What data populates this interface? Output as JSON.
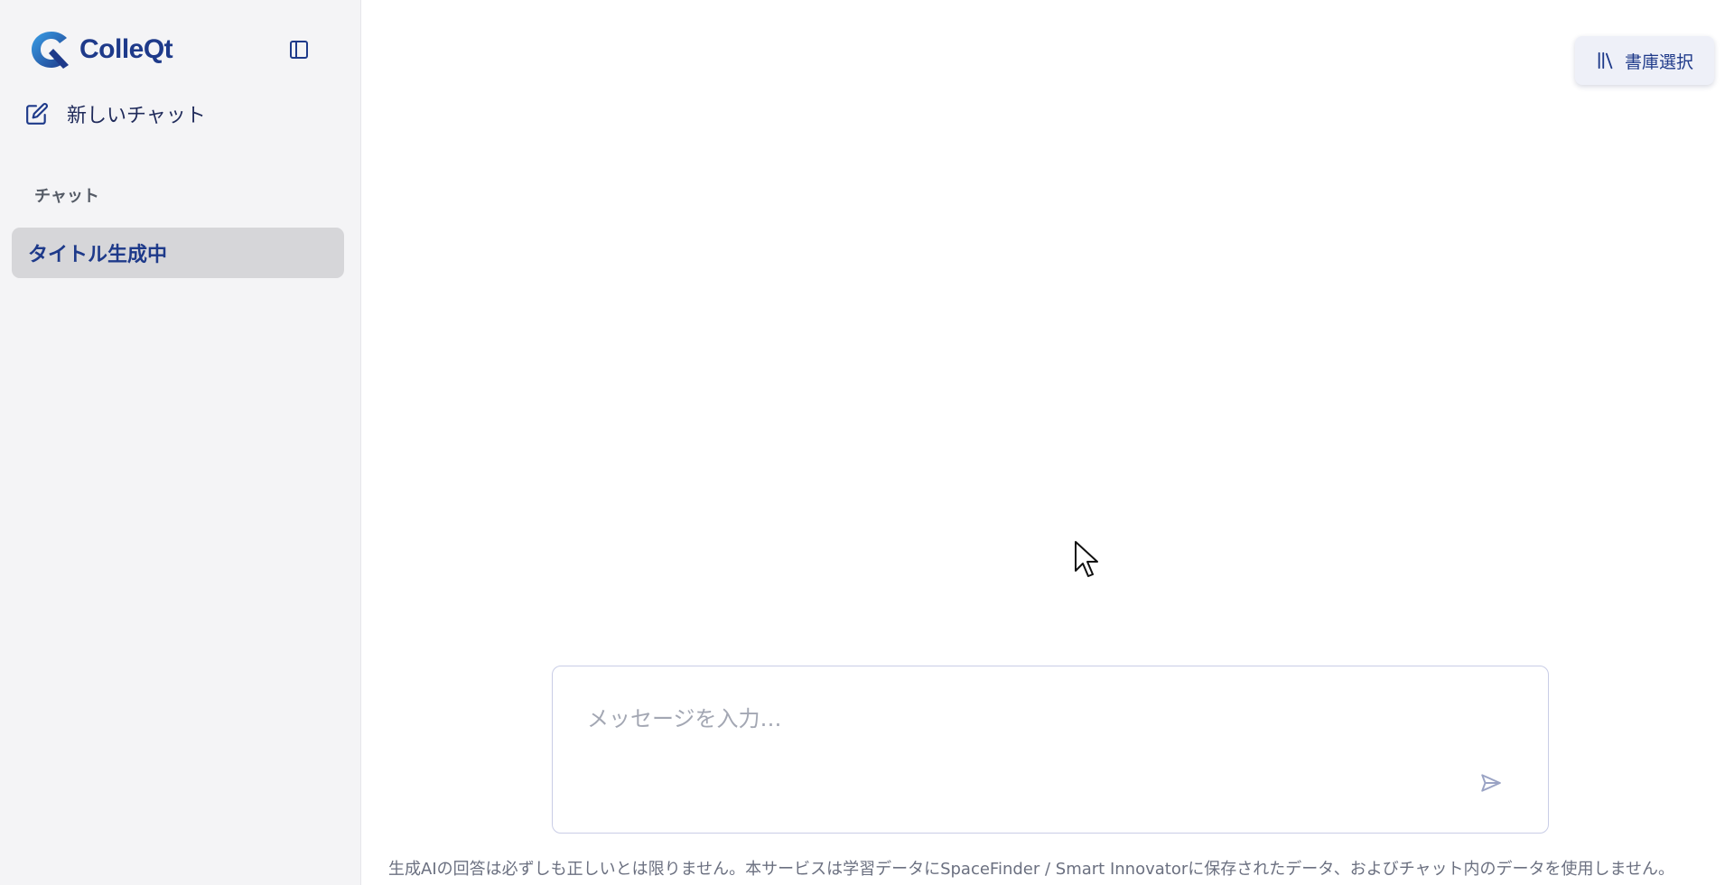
{
  "brand": {
    "name": "ColleQt",
    "accent": "#1e3a8a",
    "icon": "colleqt-logo-icon"
  },
  "sidebar": {
    "toggle_icon": "sidebar-panel-icon",
    "new_chat_label": "新しいチャット",
    "new_chat_icon": "edit-square-icon",
    "section_label": "チャット",
    "chats": [
      {
        "label": "タイトル生成中",
        "active": true
      }
    ]
  },
  "header": {
    "library_label": "書庫選択",
    "library_icon": "library-books-icon"
  },
  "composer": {
    "placeholder": "メッセージを入力…",
    "value": "",
    "send_icon": "send-paper-plane-icon"
  },
  "footer": {
    "disclaimer": "生成AIの回答は必ずしも正しいとは限りません。本サービスは学習データにSpaceFinder / Smart Innovatorに保存されたデータ、およびチャット内のデータを使用しません。"
  }
}
